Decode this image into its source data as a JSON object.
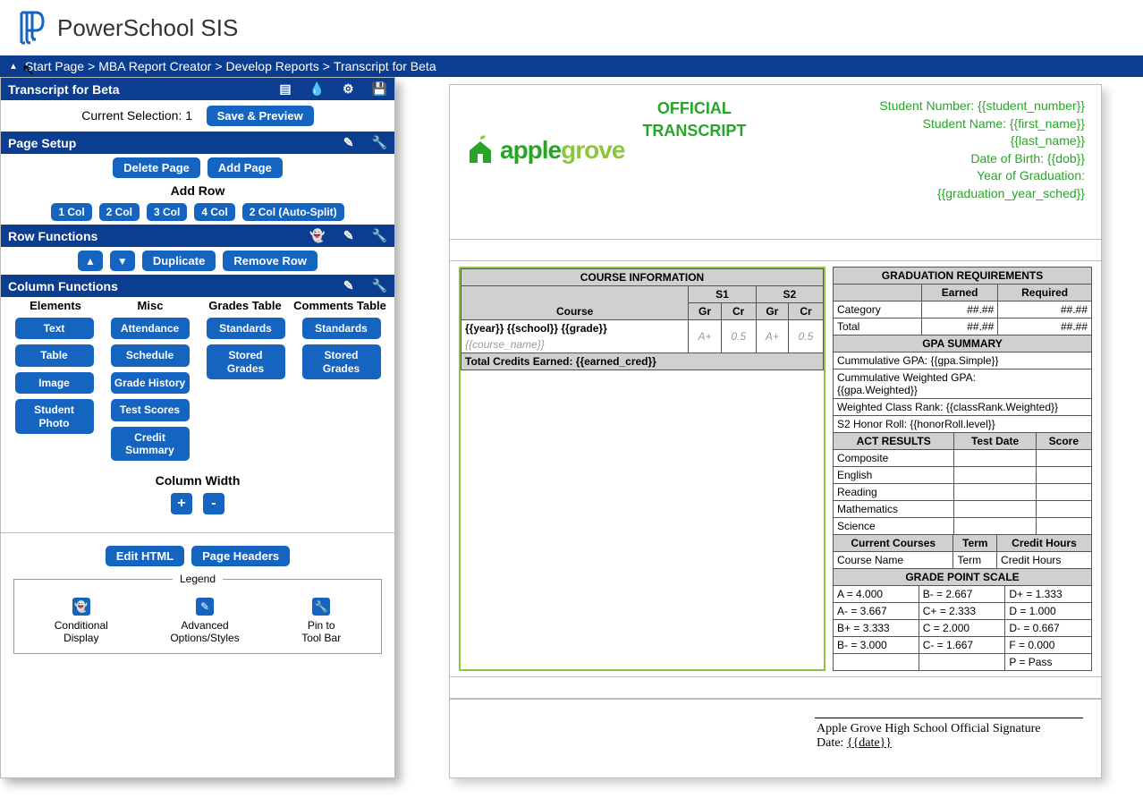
{
  "header": {
    "app_title": "PowerSchool SIS"
  },
  "breadcrumb": {
    "triangle": "▲",
    "start": "Start Page",
    "sep": " > ",
    "report_creator": "MBA Report Creator",
    "develop": "Develop Reports",
    "current": "Transcript for Beta"
  },
  "sidebar": {
    "title": "Transcript for Beta",
    "current_selection": "Current Selection: 1",
    "save_preview": "Save & Preview",
    "page_setup": "Page Setup",
    "delete_page": "Delete Page",
    "add_page": "Add Page",
    "add_row": "Add Row",
    "cols": [
      "1 Col",
      "2 Col",
      "3 Col",
      "4 Col",
      "2 Col (Auto-Split)"
    ],
    "row_functions": "Row Functions",
    "up": "▲",
    "down": "▼",
    "duplicate": "Duplicate",
    "remove_row": "Remove Row",
    "column_functions": "Column Functions",
    "col_headers": [
      "Elements",
      "Misc",
      "Grades Table",
      "Comments Table"
    ],
    "elements": [
      "Text",
      "Table",
      "Image",
      "Student Photo"
    ],
    "misc": [
      "Attendance",
      "Schedule",
      "Grade History",
      "Test Scores",
      "Credit Summary"
    ],
    "grades_tbl": [
      "Standards",
      "Stored Grades"
    ],
    "comments_tbl": [
      "Standards",
      "Stored Grades"
    ],
    "column_width": "Column Width",
    "edit_html": "Edit HTML",
    "page_headers": "Page Headers",
    "legend": {
      "title": "Legend",
      "items": [
        {
          "icon": "👻",
          "l1": "Conditional",
          "l2": "Display"
        },
        {
          "icon": "✎",
          "l1": "Advanced",
          "l2": "Options/Styles"
        },
        {
          "icon": "🔧",
          "l1": "Pin to",
          "l2": "Tool Bar"
        }
      ]
    }
  },
  "preview": {
    "logo": {
      "a": "apple",
      "g": "grove"
    },
    "title_l1": "OFFICIAL",
    "title_l2": "TRANSCRIPT",
    "student_lines": [
      "Student Number: {{student_number}}",
      "Student Name: {{first_name}}",
      "{{last_name}}",
      "Date of Birth: {{dob}}",
      "Year of Graduation:",
      "{{graduation_year_sched}}"
    ],
    "course_info": {
      "title": "COURSE INFORMATION",
      "course": "Course",
      "s1": "S1",
      "s2": "S2",
      "gr": "Gr",
      "cr": "Cr",
      "row1": "{{year}} {{school}} {{grade}}",
      "row2": "{{course_name}}",
      "gr_val": "A+",
      "cr_val": "0.5",
      "total": "Total Credits Earned: {{earned_cred}}"
    },
    "grad_req": {
      "title": "GRADUATION REQUIREMENTS",
      "earned": "Earned",
      "required": "Required",
      "category": "Category",
      "total": "Total",
      "val": "##.##"
    },
    "gpa": {
      "title": "GPA SUMMARY",
      "cum": "Cummulative GPA: {{gpa.Simple}}",
      "cumw_l1": "Cummulative Weighted GPA:",
      "cumw_l2": "{{gpa.Weighted}}",
      "rank": "Weighted Class Rank: {{classRank.Weighted}}",
      "honor": "S2 Honor Roll: {{honorRoll.level}}"
    },
    "act": {
      "title": "ACT RESULTS",
      "date": "Test Date",
      "score": "Score",
      "rows": [
        "Composite",
        "English",
        "Reading",
        "Mathematics",
        "Science"
      ]
    },
    "cc": {
      "title": "Current Courses",
      "term": "Term",
      "ch": "Credit Hours",
      "name": "Course Name"
    },
    "gps": {
      "title": "GRADE POINT SCALE",
      "rows": [
        [
          "A = 4.000",
          "B- = 2.667",
          "D+ = 1.333"
        ],
        [
          "A- = 3.667",
          "C+ = 2.333",
          "D = 1.000"
        ],
        [
          "B+ = 3.333",
          "C = 2.000",
          "D- = 0.667"
        ],
        [
          "B- = 3.000",
          "C- = 1.667",
          "F = 0.000"
        ],
        [
          "",
          "",
          "P = Pass"
        ]
      ]
    },
    "sig": {
      "school": "Apple Grove High School Official Signature",
      "date": "Date:  ",
      "date_val": "{{date}}"
    }
  }
}
